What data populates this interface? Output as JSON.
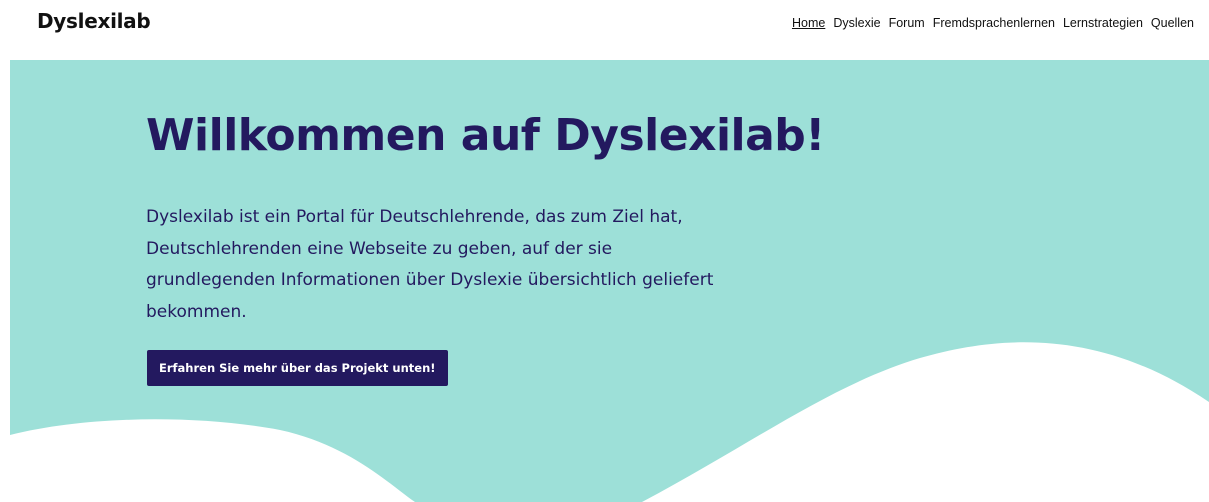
{
  "header": {
    "logo": "Dyslexilab",
    "nav": [
      {
        "label": "Home",
        "active": true
      },
      {
        "label": "Dyslexie",
        "active": false
      },
      {
        "label": "Forum",
        "active": false
      },
      {
        "label": "Fremdsprachenlernen",
        "active": false
      },
      {
        "label": "Lernstrategien",
        "active": false
      },
      {
        "label": "Quellen",
        "active": false
      }
    ]
  },
  "hero": {
    "title": "Willkommen auf Dyslexilab!",
    "text": "Dyslexilab ist ein Portal für Deutschlehrende, das zum Ziel hat, Deutschlehrenden eine Webseite zu geben, auf der sie grundlegenden Informationen über Dyslexie übersichtlich geliefert bekommen.",
    "button_label": "Erfahren Sie mehr über das Projekt unten!"
  },
  "colors": {
    "hero_background": "#9de0d8",
    "primary": "#23195f",
    "wave": "#ffffff"
  }
}
